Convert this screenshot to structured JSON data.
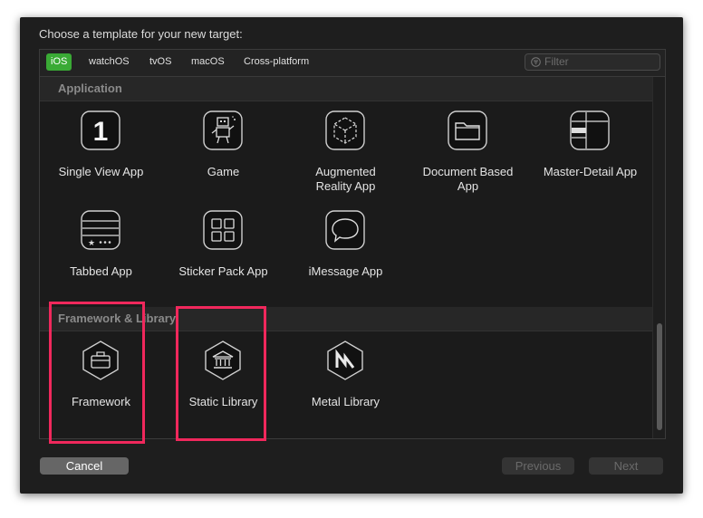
{
  "dialog": {
    "prompt": "Choose a template for your new target:"
  },
  "platform_tabs": [
    {
      "label": "iOS",
      "active": true
    },
    {
      "label": "watchOS",
      "active": false
    },
    {
      "label": "tvOS",
      "active": false
    },
    {
      "label": "macOS",
      "active": false
    },
    {
      "label": "Cross-platform",
      "active": false
    }
  ],
  "filter": {
    "placeholder": "Filter",
    "icon": "filter-icon"
  },
  "sections": [
    {
      "title": "Application",
      "templates": [
        {
          "label": "Single View App",
          "icon": "single-view-icon"
        },
        {
          "label": "Game",
          "icon": "game-robot-icon"
        },
        {
          "label": "Augmented\nReality App",
          "icon": "ar-cube-icon"
        },
        {
          "label": "Document Based\nApp",
          "icon": "folder-icon"
        },
        {
          "label": "Master-Detail App",
          "icon": "master-detail-icon"
        },
        {
          "label": "Tabbed App",
          "icon": "tabbed-icon"
        },
        {
          "label": "Sticker Pack App",
          "icon": "grid-icon"
        },
        {
          "label": "iMessage App",
          "icon": "speech-bubble-icon"
        }
      ]
    },
    {
      "title": "Framework & Library",
      "templates": [
        {
          "label": "Framework",
          "icon": "toolbox-icon"
        },
        {
          "label": "Static Library",
          "icon": "bank-icon"
        },
        {
          "label": "Metal Library",
          "icon": "metal-icon"
        }
      ]
    }
  ],
  "buttons": {
    "cancel": "Cancel",
    "previous": "Previous",
    "next": "Next"
  },
  "colors": {
    "accent_tab": "#3aaa35",
    "highlight": "#f0285c"
  },
  "single_view_glyph": "1"
}
